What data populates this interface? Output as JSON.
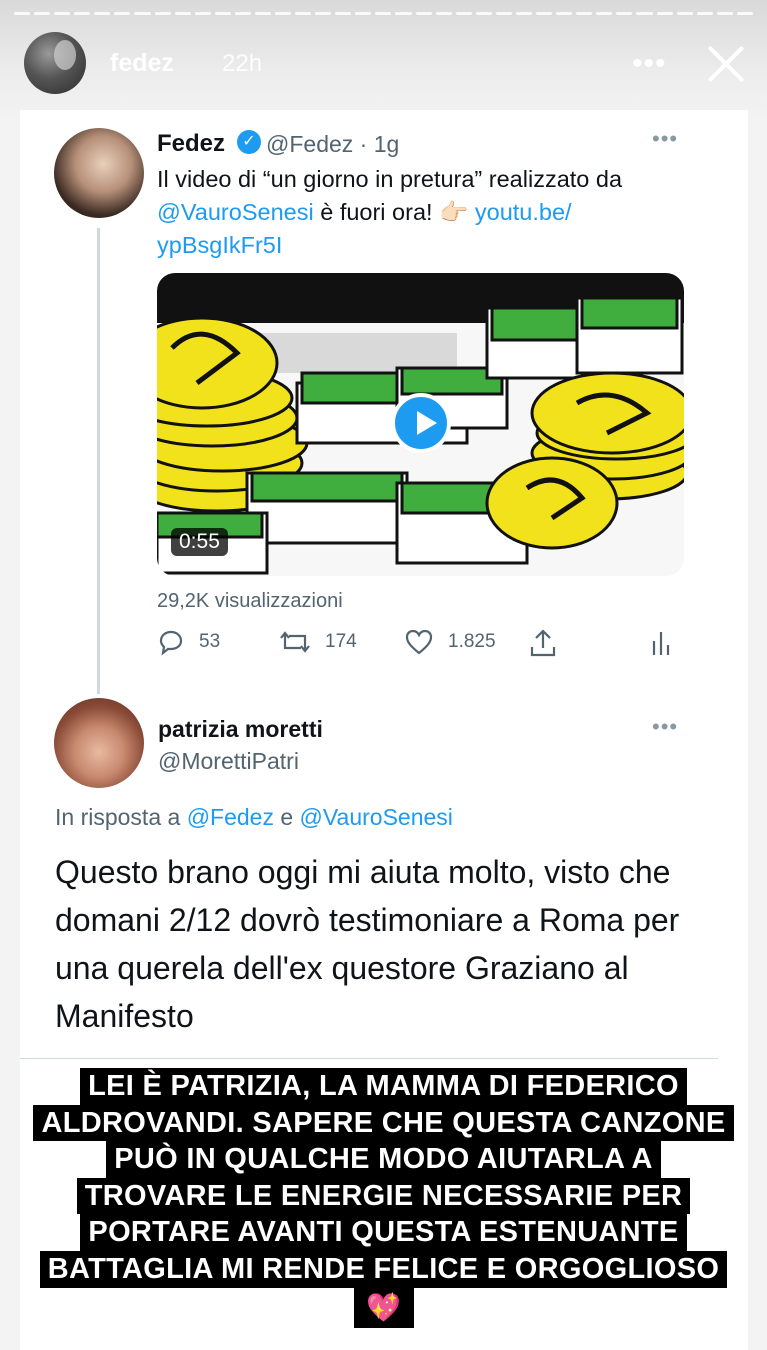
{
  "story": {
    "username": "fedez",
    "time": "22h",
    "more": "•••"
  },
  "tweet": {
    "name": "Fedez",
    "handle": "@Fedez · 1g",
    "text_before": "Il video di “un giorno in pretura” realizzato da",
    "mention": "@VauroSenesi",
    "text_middle": "è fuori ora! 👉🏻",
    "link_part1": "youtu.be/",
    "link_part2": "ypBsgIkFr5I",
    "duration": "0:55",
    "views": "29,2K visualizzazioni",
    "reply_count": "53",
    "retweet_count": "174",
    "like_count": "1.825"
  },
  "reply": {
    "name": "patrizia moretti",
    "handle": "@MorettiPatri",
    "reply_prefix": "In risposta a",
    "reply_mention1": "@Fedez",
    "reply_and": "e",
    "reply_mention2": "@VauroSenesi",
    "text": "Questo brano oggi mi aiuta molto, visto che domani 2/12 dovrò testimoniare a Roma per una querela dell'ex questore Graziano al Manifesto"
  },
  "caption": {
    "lines": [
      "LEI È PATRIZIA, LA MAMMA DI FEDERICO",
      "ALDROVANDI. SAPERE CHE QUESTA CANZONE",
      "PUÒ IN QUALCHE MODO AIUTARLA A",
      "TROVARE LE ENERGIE NECESSARIE PER",
      "PORTARE AVANTI QUESTA ESTENUANTE",
      "BATTAGLIA MI RENDE FELICE E ORGOGLIOSO"
    ],
    "emoji": "💖"
  },
  "colors": {
    "link": "#1d9bf0",
    "muted": "#536471",
    "coin": "#f2e21b",
    "money": "#3fae3f"
  }
}
